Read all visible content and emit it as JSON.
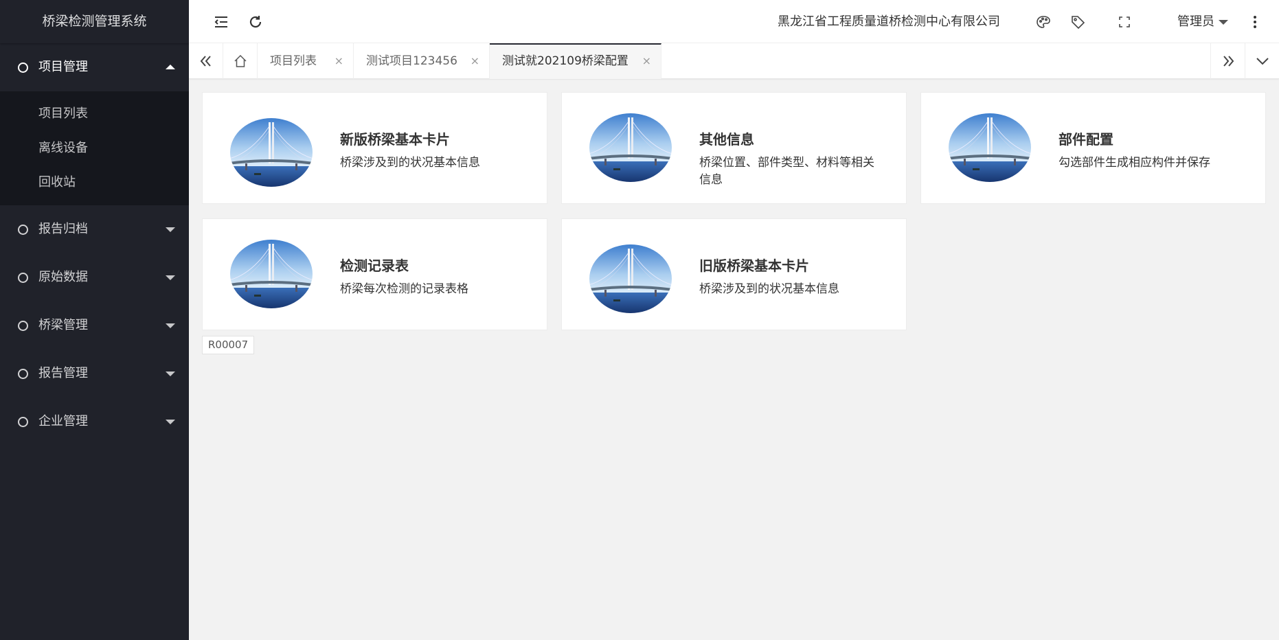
{
  "app": {
    "title": "桥梁检测管理系统"
  },
  "sidebar": {
    "groups": [
      {
        "label": "项目管理",
        "open": true,
        "children": [
          {
            "label": "项目列表"
          },
          {
            "label": "离线设备"
          },
          {
            "label": "回收站"
          }
        ]
      },
      {
        "label": "报告归档"
      },
      {
        "label": "原始数据"
      },
      {
        "label": "桥梁管理"
      },
      {
        "label": "报告管理"
      },
      {
        "label": "企业管理"
      }
    ]
  },
  "header": {
    "company": "黑龙江省工程质量道桥检测中心有限公司",
    "user": "管理员",
    "icons": [
      "menu-fold-icon",
      "refresh-icon",
      "palette-icon",
      "tag-icon",
      "fullscreen-icon",
      "more-vertical-icon"
    ]
  },
  "tabs": {
    "items": [
      {
        "label": "项目列表"
      },
      {
        "label": "测试项目123456"
      },
      {
        "label": "测试就202109桥梁配置",
        "active": true
      }
    ],
    "close_glyph": "×"
  },
  "cards": [
    {
      "title": "新版桥梁基本卡片",
      "desc": "桥梁涉及到的状况基本信息"
    },
    {
      "title": "其他信息",
      "desc": "桥梁位置、部件类型、材料等相关信息"
    },
    {
      "title": "部件配置",
      "desc": "勾选部件生成相应构件并保存"
    },
    {
      "title": "检测记录表",
      "desc": "桥梁每次检测的记录表格"
    },
    {
      "title": "旧版桥梁基本卡片",
      "desc": "桥梁涉及到的状况基本信息"
    }
  ],
  "footer_code": "R00007",
  "colors": {
    "sidebar_bg": "#20222a",
    "submenu_bg": "#15171d",
    "content_bg": "#f2f2f2"
  }
}
